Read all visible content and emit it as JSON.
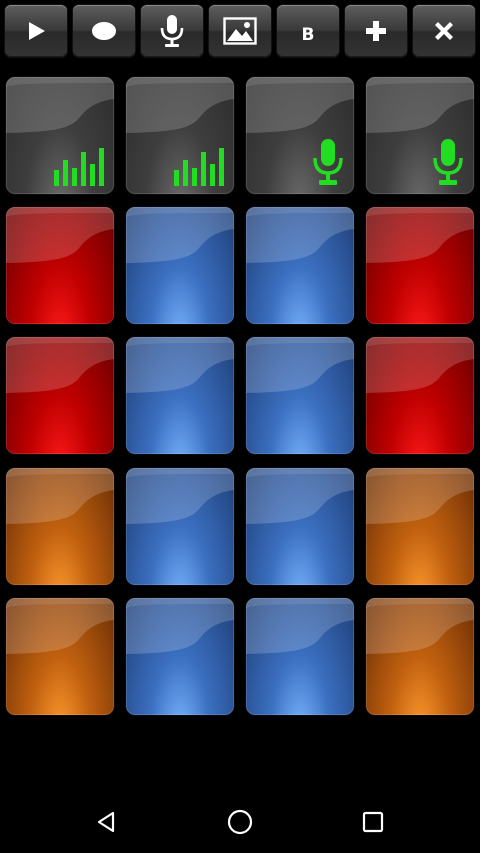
{
  "toolbar": {
    "buttons": [
      {
        "name": "play-button",
        "icon": "play-icon"
      },
      {
        "name": "record-button",
        "icon": "record-dot-icon"
      },
      {
        "name": "mic-button",
        "icon": "microphone-icon"
      },
      {
        "name": "image-button",
        "icon": "image-icon"
      },
      {
        "name": "b-button",
        "icon": "",
        "label": "B"
      },
      {
        "name": "add-button",
        "icon": "plus-icon"
      },
      {
        "name": "close-button",
        "icon": "close-icon"
      }
    ]
  },
  "pads": {
    "rows": [
      [
        "gray-equalizer",
        "gray-equalizer",
        "gray-microphone",
        "gray-microphone"
      ],
      [
        "red",
        "blue",
        "blue",
        "red"
      ],
      [
        "red",
        "blue",
        "blue",
        "red"
      ],
      [
        "orange",
        "blue",
        "blue",
        "orange"
      ],
      [
        "orange",
        "blue",
        "blue",
        "orange"
      ]
    ],
    "icon_color": "#22dd22"
  },
  "navbar": {
    "buttons": [
      "back-icon",
      "home-icon",
      "recents-icon"
    ]
  },
  "colors": {
    "background": "#000000",
    "red": "#c00000",
    "blue": "#3b6fc0",
    "orange": "#c0600f",
    "gray": "#3e3e3e",
    "accent_green": "#22dd22"
  }
}
